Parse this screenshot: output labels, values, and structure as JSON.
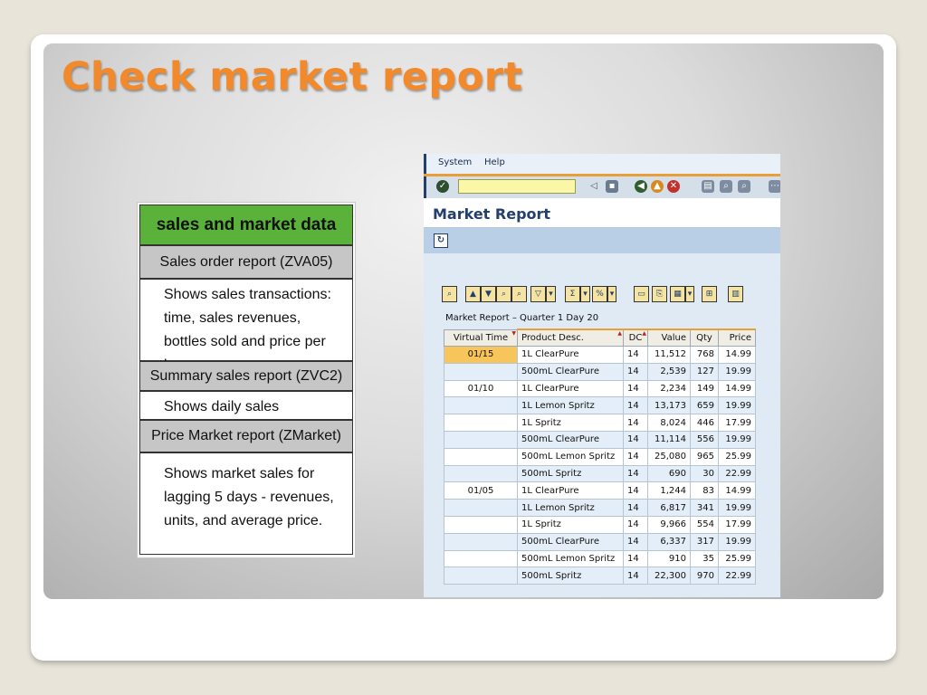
{
  "slide": {
    "title": "Check market report"
  },
  "legend": {
    "header": "sales and market data",
    "sections": [
      {
        "label": "Sales order report (ZVA05)",
        "description": "Shows sales transactions: time, sales revenues, bottles sold and price per box."
      },
      {
        "label": "Summary sales report (ZVC2)",
        "description": "Shows  daily sales"
      },
      {
        "label": "Price Market report (ZMarket)",
        "description": "Shows market sales for lagging 5 days - revenues, units, and average price."
      }
    ]
  },
  "sap": {
    "menu": [
      "System",
      "Help"
    ],
    "toolbar_icons": [
      "enter-icon",
      "back-icon",
      "save-icon",
      "back-nav-icon",
      "exit-icon",
      "cancel-icon",
      "print-icon",
      "find-icon",
      "find-next-icon"
    ],
    "title": "Market Report",
    "execute_icon": "refresh-icon",
    "caption": "Market Report – Quarter 1 Day 20",
    "columns": [
      "Virtual Time",
      "Product Desc.",
      "DC",
      "Value",
      "Qty",
      "Price"
    ],
    "rows": [
      [
        "01/15",
        "1L ClearPure",
        "14",
        "11,512",
        "768",
        "14.99"
      ],
      [
        "",
        "500mL ClearPure",
        "14",
        "2,539",
        "127",
        "19.99"
      ],
      [
        "01/10",
        "1L ClearPure",
        "14",
        "2,234",
        "149",
        "14.99"
      ],
      [
        "",
        "1L Lemon Spritz",
        "14",
        "13,173",
        "659",
        "19.99"
      ],
      [
        "",
        "1L Spritz",
        "14",
        "8,024",
        "446",
        "17.99"
      ],
      [
        "",
        "500mL ClearPure",
        "14",
        "11,114",
        "556",
        "19.99"
      ],
      [
        "",
        "500mL Lemon Spritz",
        "14",
        "25,080",
        "965",
        "25.99"
      ],
      [
        "",
        "500mL Spritz",
        "14",
        "690",
        "30",
        "22.99"
      ],
      [
        "01/05",
        "1L ClearPure",
        "14",
        "1,244",
        "83",
        "14.99"
      ],
      [
        "",
        "1L Lemon Spritz",
        "14",
        "6,817",
        "341",
        "19.99"
      ],
      [
        "",
        "1L Spritz",
        "14",
        "9,966",
        "554",
        "17.99"
      ],
      [
        "",
        "500mL ClearPure",
        "14",
        "6,337",
        "317",
        "19.99"
      ],
      [
        "",
        "500mL Lemon Spritz",
        "14",
        "910",
        "35",
        "25.99"
      ],
      [
        "",
        "500mL Spritz",
        "14",
        "22,300",
        "970",
        "22.99"
      ]
    ]
  }
}
